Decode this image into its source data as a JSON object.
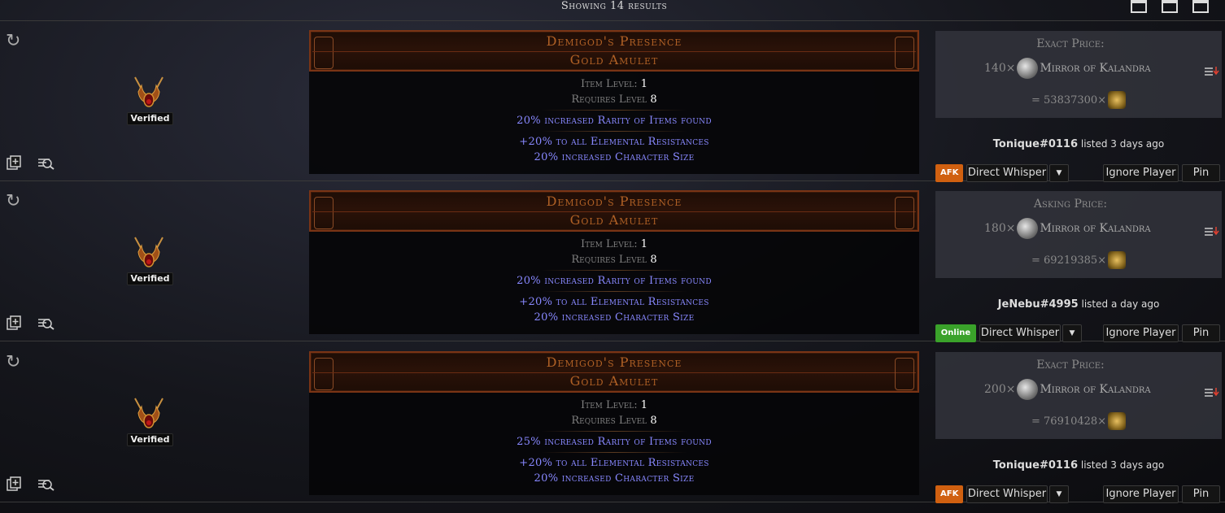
{
  "header": {
    "showing": "Showing 14 results"
  },
  "results": [
    {
      "verified": "Verified",
      "item_name": "Demigod's Presence",
      "item_base": "Gold Amulet",
      "item_level_label": "Item Level:",
      "item_level": "1",
      "req_label": "Requires Level",
      "req_level": "8",
      "implicit": "20% increased Rarity of Items found",
      "mod1": "+20% to all Elemental Resistances",
      "mod2": "20% increased Character Size",
      "price_label": "Exact Price:",
      "price_qty": "140×",
      "price_currency": "Mirror of Kalandra",
      "chaos_equiv": "= 53837300×",
      "seller": "Tonique#0116",
      "listed": "listed 3 days ago",
      "status": "AFK",
      "status_color": "#d06010",
      "whisper": "Direct Whisper",
      "ignore": "Ignore Player",
      "pin": "Pin"
    },
    {
      "verified": "Verified",
      "item_name": "Demigod's Presence",
      "item_base": "Gold Amulet",
      "item_level_label": "Item Level:",
      "item_level": "1",
      "req_label": "Requires Level",
      "req_level": "8",
      "implicit": "20% increased Rarity of Items found",
      "mod1": "+20% to all Elemental Resistances",
      "mod2": "20% increased Character Size",
      "price_label": "Asking Price:",
      "price_qty": "180×",
      "price_currency": "Mirror of Kalandra",
      "chaos_equiv": "= 69219385×",
      "seller": "JeNebu#4995",
      "listed": "listed a day ago",
      "status": "Online",
      "status_color": "#3aa22a",
      "whisper": "Direct Whisper",
      "ignore": "Ignore Player",
      "pin": "Pin"
    },
    {
      "verified": "Verified",
      "item_name": "Demigod's Presence",
      "item_base": "Gold Amulet",
      "item_level_label": "Item Level:",
      "item_level": "1",
      "req_label": "Requires Level",
      "req_level": "8",
      "implicit": "25% increased Rarity of Items found",
      "mod1": "+20% to all Elemental Resistances",
      "mod2": "20% increased Character Size",
      "price_label": "Exact Price:",
      "price_qty": "200×",
      "price_currency": "Mirror of Kalandra",
      "chaos_equiv": "= 76910428×",
      "seller": "Tonique#0116",
      "listed": "listed 3 days ago",
      "status": "AFK",
      "status_color": "#d06010",
      "whisper": "Direct Whisper",
      "ignore": "Ignore Player",
      "pin": "Pin"
    }
  ]
}
